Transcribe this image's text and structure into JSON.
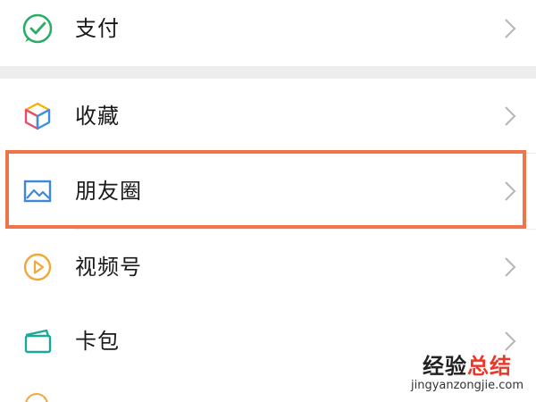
{
  "menu": {
    "pay": {
      "label": "支付",
      "icon": "wechat-pay-icon"
    },
    "favorites": {
      "label": "收藏",
      "icon": "cube-icon"
    },
    "moments": {
      "label": "朋友圈",
      "icon": "image-icon",
      "highlighted": true
    },
    "channels": {
      "label": "视频号",
      "icon": "play-circle-icon"
    },
    "cards": {
      "label": "卡包",
      "icon": "card-icon"
    }
  },
  "highlight_color": "#f0744a",
  "watermark": {
    "part1": "经验",
    "part2": "总结",
    "url": "jingyanzongjie.com",
    "part1_color": "#222222",
    "part2_color": "#e8392c"
  }
}
